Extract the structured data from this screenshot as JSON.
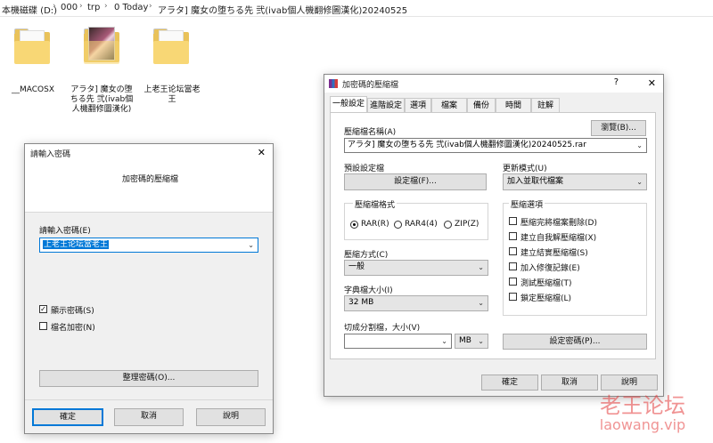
{
  "breadcrumb": [
    "本機磁碟 (D:)",
    "000",
    "trp",
    "0 Today",
    "アラタ] 魔女の堕ちる先 弐(ivab個人機翻修圖漢化)20240525"
  ],
  "folders": [
    {
      "label": "__MACOSX",
      "icon": "folder-icon"
    },
    {
      "label": "アラタ] 魔女の堕ちる先 弐(ivab個人機翻修圖漢化)",
      "icon": "folder-thumbnail-icon"
    },
    {
      "label": "上老王论坛當老王",
      "icon": "folder-icon"
    }
  ],
  "password_dialog": {
    "title": "請輸入密碼",
    "close": "✕",
    "header": "加密碼的壓縮檔",
    "password_label": "請輸入密碼(E)",
    "password_value": "上老王论坛當老王",
    "show_password_label": "顯示密碼(S)",
    "show_password_checked": true,
    "encrypt_names_label": "檔名加密(N)",
    "encrypt_names_checked": false,
    "organize_button": "整理密碼(O)...",
    "ok_button": "確定",
    "cancel_button": "取消",
    "help_button": "說明"
  },
  "archive_dialog": {
    "title": "加密碼的壓縮檔",
    "help_mark": "?",
    "close": "✕",
    "tabs": [
      "一般設定",
      "進階設定",
      "選項",
      "檔案",
      "備份",
      "時間",
      "註解"
    ],
    "archive_name_label": "壓縮檔名稱(A)",
    "browse_button": "瀏覽(B)...",
    "archive_name_value": "アラタ] 魔女の堕ちる先 弐(ivab個人機翻修圖漢化)20240525.rar",
    "profiles_label": "預設設定檔",
    "profiles_button": "設定檔(F)...",
    "update_mode_label": "更新模式(U)",
    "update_mode_value": "加入並取代檔案",
    "format_label": "壓縮檔格式",
    "formats": [
      "RAR(R)",
      "RAR4(4)",
      "ZIP(Z)"
    ],
    "selected_format": "RAR(R)",
    "method_label": "壓縮方式(C)",
    "method_value": "一般",
    "dict_label": "字典檔大小(I)",
    "dict_value": "32 MB",
    "split_label": "切成分割檔，大小(V)",
    "split_value": "",
    "split_unit": "MB",
    "options_label": "壓縮選項",
    "options": [
      {
        "label": "壓縮完將檔案刪除(D)",
        "checked": false
      },
      {
        "label": "建立自我解壓縮檔(X)",
        "checked": false
      },
      {
        "label": "建立結實壓縮檔(S)",
        "checked": false
      },
      {
        "label": "加入修復記錄(E)",
        "checked": false
      },
      {
        "label": "測試壓縮檔(T)",
        "checked": false
      },
      {
        "label": "鎖定壓縮檔(L)",
        "checked": false
      }
    ],
    "set_password_button": "設定密碼(P)...",
    "ok_button": "確定",
    "cancel_button": "取消",
    "help_button": "說明"
  },
  "watermark": {
    "line1": "老王论坛",
    "line2": "laowang.vip"
  }
}
